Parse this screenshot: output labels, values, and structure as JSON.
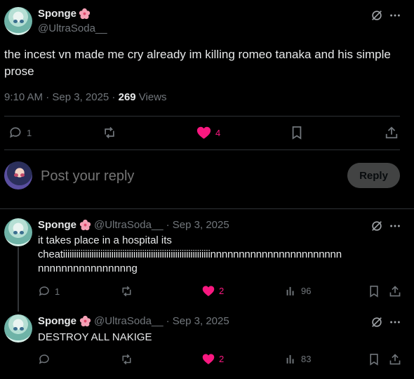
{
  "main_post": {
    "display_name": "Sponge",
    "handle": "@UltraSoda__",
    "text": "the incest vn made me cry already im killing romeo tanaka and his simple prose",
    "time": "9:10 AM · Sep 3, 2025 · ",
    "views_count": "269",
    "views_label": " Views",
    "stats": {
      "replies": "1",
      "reposts": "",
      "likes": "4"
    }
  },
  "compose": {
    "placeholder": "Post your reply",
    "reply_button": "Reply"
  },
  "replies": [
    {
      "display_name": "Sponge",
      "handle": "@UltraSoda__",
      "date": "· Sep 3, 2025",
      "text_line1": "it takes place in a hospital its",
      "text_line2": "cheatiiiiiiiiiiiiiiiiiiiiiiiiiiiiiiiiiiiiiiiiiiiiiiiiiiiiiiiiiiiiiiiiiiinnnnnnnnnnnnnnnnnnnnnnn",
      "text_line3": "nnnnnnnnnnnnnnnng",
      "replies": "1",
      "likes": "2",
      "views": "96"
    },
    {
      "display_name": "Sponge",
      "handle": "@UltraSoda__",
      "date": "· Sep 3, 2025",
      "text_line1": "DESTROY ALL NAKIGE",
      "replies": "",
      "likes": "2",
      "views": "83"
    }
  ],
  "colors": {
    "accent_like": "#f91880",
    "muted": "#71767b",
    "text": "#e7e9ea",
    "background": "#000000"
  },
  "icons": {
    "badge": "hibiscus-icon",
    "grok": "grok-icon",
    "more": "more-icon",
    "reply": "reply-icon",
    "repost": "repost-icon",
    "like": "heart-icon",
    "bookmark": "bookmark-icon",
    "share": "share-icon",
    "views": "views-icon"
  }
}
